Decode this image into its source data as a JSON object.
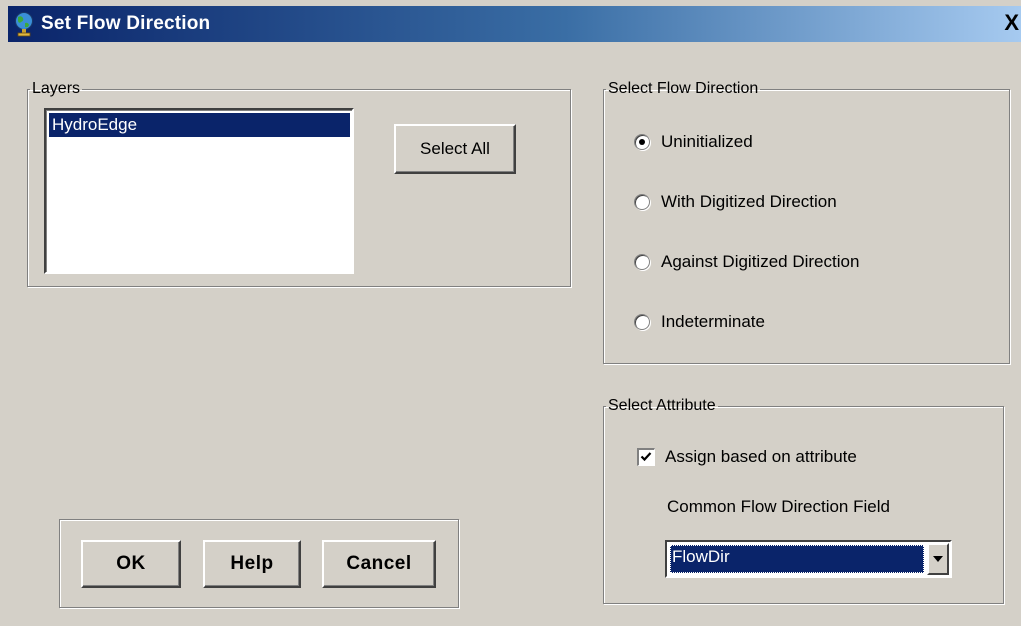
{
  "window": {
    "title": "Set Flow Direction",
    "close_label": "X",
    "icon": "globe-icon"
  },
  "layers": {
    "legend": "Layers",
    "items": [
      "HydroEdge"
    ],
    "select_all_label": "Select All"
  },
  "flow_direction": {
    "legend": "Select Flow Direction",
    "options": [
      {
        "label": "Uninitialized",
        "selected": true
      },
      {
        "label": "With Digitized Direction",
        "selected": false
      },
      {
        "label": "Against Digitized Direction",
        "selected": false
      },
      {
        "label": "Indeterminate",
        "selected": false
      }
    ]
  },
  "attribute": {
    "legend": "Select Attribute",
    "assign_label": "Assign based on attribute",
    "assign_checked": true,
    "field_label": "Common Flow Direction Field",
    "field_value": "FlowDir"
  },
  "buttons": {
    "ok": "OK",
    "help": "Help",
    "cancel": "Cancel"
  },
  "colors": {
    "title_bar_start": "#0a246a",
    "title_bar_end": "#a6caf0",
    "selection": "#0a246a",
    "face": "#d4d0c8"
  }
}
